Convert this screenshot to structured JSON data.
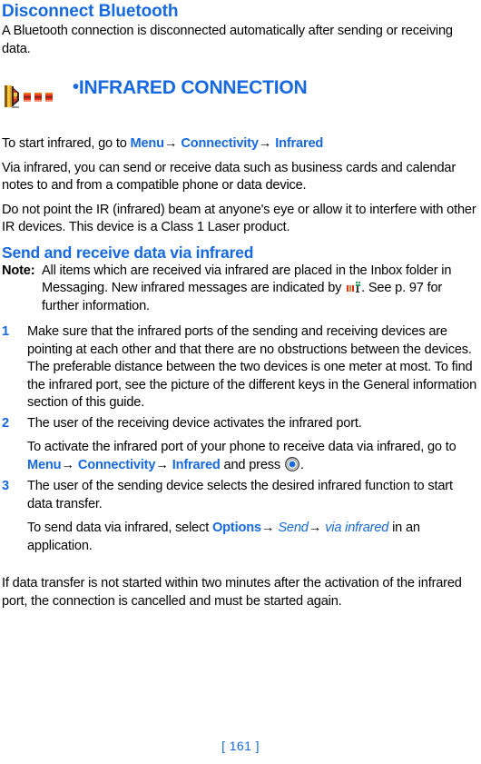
{
  "section_disconnect": {
    "heading": "Disconnect Bluetooth",
    "paragraph": "A Bluetooth connection is disconnected automatically after sending or receiving data."
  },
  "chapter": {
    "bullet": "•",
    "title": "INFRARED CONNECTION",
    "icon_name": "infrared-beam-icon"
  },
  "intro": {
    "line1_prefix": "To start infrared, go to ",
    "menu": "Menu",
    "arrow": "→",
    "connectivity": "Connectivity",
    "infrared": "Infrared",
    "paragraph_via": "Via infrared, you can send or receive data such as business cards and calendar notes to and from a compatible phone or data device.",
    "paragraph_warning": "Do not point the IR (infrared) beam at anyone's eye or allow it to interfere with other IR devices. This device is a Class 1 Laser product."
  },
  "section_send": {
    "heading": "Send and receive data via infrared",
    "note_label": "Note:",
    "note_text_before_icon": "All items which are received via infrared are placed in the Inbox folder in Messaging. New infrared messages are indicated by ",
    "note_text_after_icon": ". See p. 97 for further information.",
    "note_icon_name": "infrared-message-indicator-icon"
  },
  "steps": [
    {
      "number": "1",
      "text": "Make sure that the infrared ports of the sending and receiving devices are pointing at each other and that there are no obstructions between the devices. The preferable distance between the two devices is one meter at most. To find the infrared port, see the picture of the different keys in the General information section of this guide."
    },
    {
      "number": "2",
      "text": "The user of the receiving device activates the infrared port.",
      "sub_prefix": "To activate the infrared port of your phone to receive data via infrared, go to ",
      "sub_menu": "Menu",
      "sub_connectivity": "Connectivity",
      "sub_infrared": "Infrared",
      "sub_middle": " and press ",
      "sub_suffix": ".",
      "sub_icon_name": "scroll-key-icon"
    },
    {
      "number": "3",
      "text": "The user of the sending device selects the desired infrared function to start data transfer.",
      "sub_prefix": "To send data via infrared, select ",
      "sub_options": "Options",
      "sub_send": "Send",
      "sub_via_infrared": "via infrared",
      "sub_suffix": " in an application."
    }
  ],
  "closing_paragraph": "If data transfer is not started within two minutes after the activation of the infrared port, the connection is cancelled and must be started again.",
  "footer": {
    "page_number": "[ 161 ]"
  },
  "colors": {
    "accent_blue": "#1669e0",
    "icon_red": "#e03020",
    "icon_orange": "#f07818",
    "icon_yellow": "#f5c842",
    "icon_green": "#1f9a5a",
    "text_black": "#000000"
  }
}
